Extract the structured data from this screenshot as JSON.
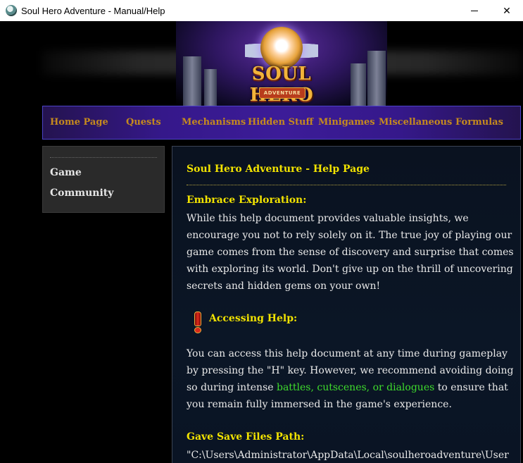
{
  "window": {
    "title": "Soul Hero Adventure - Manual/Help",
    "minimize_icon": "minimize-icon",
    "close_label": "✕"
  },
  "banner": {
    "logo_text": "SOUL HERO",
    "logo_subtext": "ADVENTURE"
  },
  "nav": {
    "items": [
      {
        "label": "Home Page"
      },
      {
        "label": "Quests"
      },
      {
        "label": "Mechanisms"
      },
      {
        "label": "Hidden Stuff"
      },
      {
        "label": "Minigames"
      },
      {
        "label": "Miscellaneous"
      },
      {
        "label": "Formulas"
      }
    ]
  },
  "sidebar": {
    "items": [
      {
        "label": "Game"
      },
      {
        "label": "Community"
      }
    ]
  },
  "content": {
    "title": "Soul Hero Adventure - Help Page",
    "exploration_heading": "Embrace Exploration:",
    "exploration_text": "While this help document provides valuable insights, we encourage you not to rely solely on it. The true joy of playing our game comes from the sense of discovery and surprise that comes with exploring its world. Don't give up on the thrill of uncovering secrets and hidden gems on your own!",
    "access_heading": "Accessing Help:",
    "access_text_before": "You can access this help document at any time during gameplay by pressing the \"H\" key. However, we recommend avoiding doing so during intense ",
    "access_text_highlight": "battles, cutscenes, or dialogues",
    "access_text_after": " to ensure that you remain fully immersed in the game's experience.",
    "save_heading": "Gave Save Files Path:",
    "save_path": "\"C:\\Users\\Administrator\\AppData\\Local\\soulheroadventure\\User"
  },
  "colors": {
    "heading": "#f2e300",
    "nav_text": "#c58a1e",
    "highlight": "#3fdb2c",
    "nav_bg": "#35188a"
  }
}
